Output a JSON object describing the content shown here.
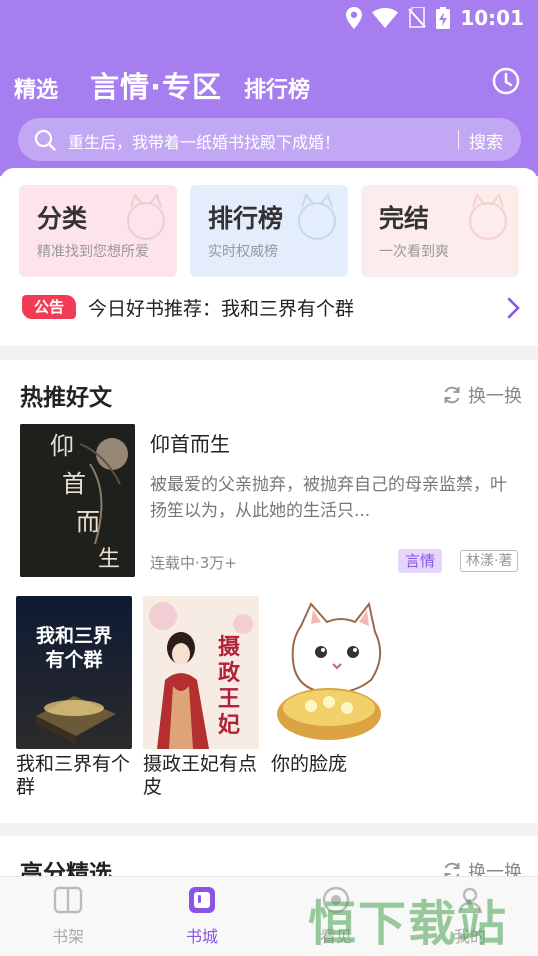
{
  "status_bar": {
    "time": "10:01",
    "icons": [
      "location-icon",
      "wifi-icon",
      "no-sim-icon",
      "battery-charging-icon"
    ]
  },
  "header": {
    "tabs": [
      {
        "label": "精选"
      },
      {
        "label": "言情·专区",
        "active": true
      },
      {
        "label": "排行榜"
      }
    ],
    "history_icon": "clock-icon"
  },
  "search": {
    "placeholder": "重生后，我带着一纸婚书找殿下成婚！",
    "button": "搜索"
  },
  "features": [
    {
      "title": "分类",
      "subtitle": "精准找到您想所爱"
    },
    {
      "title": "排行榜",
      "subtitle": "实时权威榜"
    },
    {
      "title": "完结",
      "subtitle": "一次看到爽"
    }
  ],
  "notice": {
    "badge": "公告",
    "text": "今日好书推荐：我和三界有个群"
  },
  "hot": {
    "title": "热推好文",
    "refresh": "换一换",
    "lead": {
      "title": "仰首而生",
      "description": "被最爱的父亲抛弃，被抛弃自己的母亲监禁，叶扬笙以为，从此她的生活只...",
      "meta": "连载中·3万+",
      "genre": "言情",
      "author": "林漾·著",
      "cover_text": "仰首而生"
    },
    "books": [
      {
        "title": "我和三界有个群",
        "cover_text": "我和三界有个群"
      },
      {
        "title": "摄政王妃有点皮",
        "cover_text": "摄政王妃"
      },
      {
        "title": "你的脸庞",
        "cover_text": ""
      }
    ]
  },
  "high_score": {
    "title": "高分精选",
    "refresh": "换一换"
  },
  "bottom_nav": [
    {
      "label": "书架"
    },
    {
      "label": "书城",
      "active": true
    },
    {
      "label": "看见"
    },
    {
      "label": "我的"
    }
  ],
  "watermark": "恒下载站",
  "colors": {
    "primary": "#a67ef0",
    "accent": "#8a55e6",
    "notice_red": "#f23b55"
  }
}
